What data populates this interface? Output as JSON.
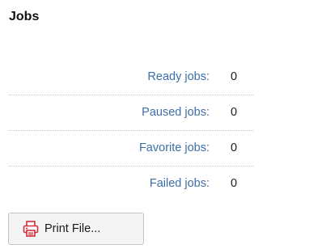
{
  "panel": {
    "title": "Jobs"
  },
  "stats": [
    {
      "label": "Ready jobs:",
      "value": "0"
    },
    {
      "label": "Paused jobs:",
      "value": "0"
    },
    {
      "label": "Favorite jobs:",
      "value": "0"
    },
    {
      "label": "Failed jobs:",
      "value": "0"
    }
  ],
  "print_button": {
    "label": "Print File...",
    "icon": "printer-icon"
  },
  "colors": {
    "link_label": "#3d6fa8",
    "printer_icon": "#d32f3a"
  }
}
